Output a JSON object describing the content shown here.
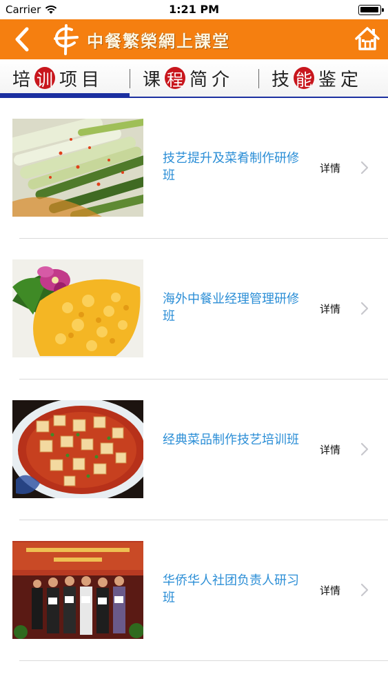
{
  "status_bar": {
    "carrier": "Carrier",
    "time": "1:21 PM"
  },
  "nav": {
    "title": "中餐繁榮網上課堂",
    "back_icon": "back-chevron-icon",
    "home_icon": "home-icon",
    "logo_icon": "chinese-logo-icon",
    "background_color": "#f57f10"
  },
  "tabs": [
    {
      "prefix": "培",
      "highlight": "训",
      "suffix": "项目",
      "active": true
    },
    {
      "prefix": "课",
      "highlight": "程",
      "suffix": "简介",
      "active": false
    },
    {
      "prefix": "技",
      "highlight": "能",
      "suffix": "鉴定",
      "active": false
    }
  ],
  "courses": [
    {
      "title": "技艺提升及菜肴制作研修班",
      "detail": "详情",
      "image": "vegetable-dish-photo"
    },
    {
      "title": "海外中餐业经理管理研修班",
      "detail": "详情",
      "image": "egg-dish-photo"
    },
    {
      "title": "经典菜品制作技艺培训班",
      "detail": "详情",
      "image": "mapo-tofu-photo"
    },
    {
      "title": "华侨华人社团负责人研习班",
      "detail": "详情",
      "image": "ceremony-photo"
    }
  ],
  "colors": {
    "accent_blue": "#1b2fa0",
    "link_blue": "#2b8ed6",
    "highlight_red": "#c8161d"
  }
}
